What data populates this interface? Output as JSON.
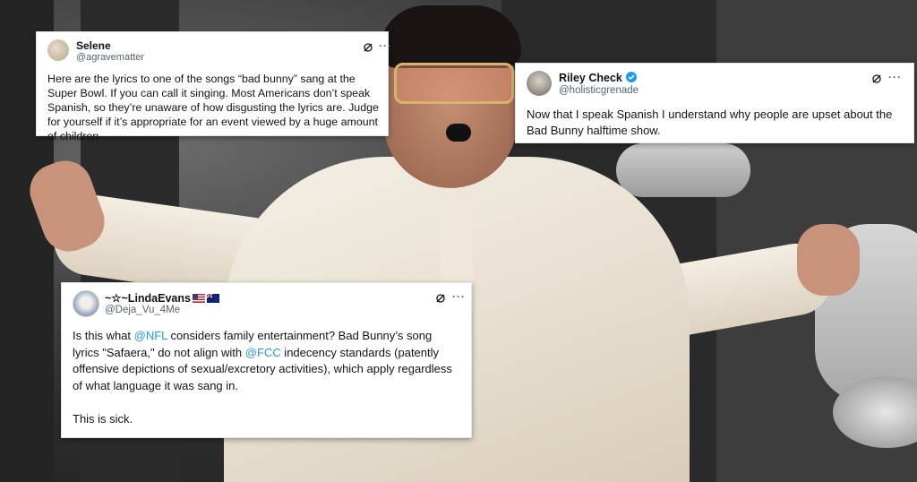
{
  "tweets": [
    {
      "name": "Selene",
      "handle": "@agravematter",
      "text": "Here are the lyrics to one of the songs “bad bunny” sang at the Super Bowl. If you can call it singing. Most Americans don’t speak Spanish, so they’re unaware of how disgusting the lyrics are. Judge for yourself if it’s appropriate for an event viewed by a huge amount of children",
      "more_label": "···"
    },
    {
      "name": "Riley Check",
      "handle": "@holisticgrenade",
      "text": "Now that I speak Spanish I understand why people are upset about the Bad Bunny halftime show.",
      "more_label": "···"
    },
    {
      "name": "~☆~LindaEvans",
      "handle": "@Deja_Vu_4Me",
      "text_1": "Is this what ",
      "mention_1": "@NFL",
      "text_2": " considers family entertainment? Bad Bunny’s song lyrics \"Safaera,\" do not align with ",
      "mention_2": "@FCC",
      "text_3": " indecency standards (patently offensive depictions of sexual/excretory activities), which apply regardless of what language it was sang in.",
      "text_4": "This is sick.",
      "more_label": "···"
    }
  ],
  "colors": {
    "link": "#1d9bf0",
    "verified": "#1d9bf0",
    "text": "#0f1419",
    "muted": "#536471"
  },
  "icons": [
    "grok-icon",
    "more-icon",
    "verified-badge-icon",
    "us-flag-icon",
    "nz-flag-icon"
  ]
}
